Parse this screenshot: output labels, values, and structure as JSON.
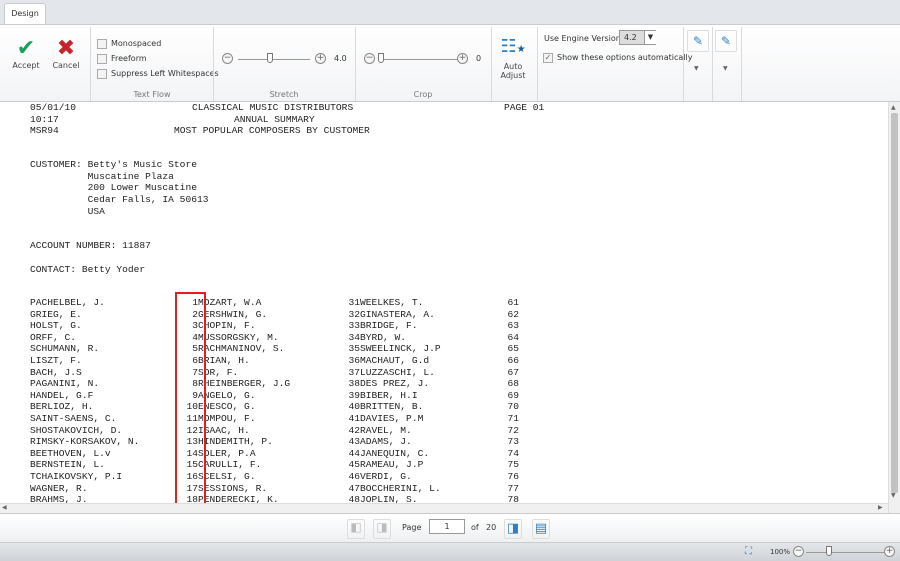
{
  "tabs": [
    {
      "label": "Design"
    }
  ],
  "ribbon": {
    "accept": "Accept",
    "cancel": "Cancel",
    "text_flow": {
      "label": "Text Flow",
      "options": [
        {
          "label": "Monospaced",
          "checked": false
        },
        {
          "label": "Freeform",
          "checked": false
        },
        {
          "label": "Suppress Left Whitespaces",
          "checked": false
        }
      ]
    },
    "stretch": {
      "label": "Stretch",
      "value": "4.0",
      "fraction": 0.45
    },
    "crop": {
      "label": "Crop",
      "value": "0",
      "fraction": 0.0
    },
    "auto_adjust": "Auto Adjust",
    "engine_label": "Use Engine Version",
    "engine_value": "4.2",
    "show_auto": "Show these options automatically",
    "show_auto_checked": true
  },
  "document": {
    "header": [
      {
        "left": "05/01/10",
        "center": "CLASSICAL MUSIC DISTRIBUTORS",
        "right": "PAGE 01"
      },
      {
        "left": "10:17",
        "center": "ANNUAL SUMMARY",
        "right": ""
      },
      {
        "left": "MSR94",
        "center": "MOST POPULAR COMPOSERS BY CUSTOMER",
        "right": ""
      }
    ],
    "customer": [
      "CUSTOMER: Betty's Music Store",
      "          Muscatine Plaza",
      "          200 Lower Muscatine",
      "          Cedar Falls, IA 50613",
      "          USA"
    ],
    "account": "ACCOUNT NUMBER: 11887",
    "contact": "CONTACT: Betty Yoder",
    "rows": [
      [
        "PACHELBEL, J.",
        "1",
        "MOZART, W.A",
        "31",
        "WEELKES, T.",
        "61"
      ],
      [
        "GRIEG, E.",
        "2",
        "GERSHWIN, G.",
        "32",
        "GINASTERA, A.",
        "62"
      ],
      [
        "HOLST, G.",
        "3",
        "CHOPIN, F.",
        "33",
        "BRIDGE, F.",
        "63"
      ],
      [
        "ORFF, C.",
        "4",
        "MUSSORGSKY, M.",
        "34",
        "BYRD, W.",
        "64"
      ],
      [
        "SCHUMANN, R.",
        "5",
        "RACHMANINOV, S.",
        "35",
        "SWEELINCK, J.P",
        "65"
      ],
      [
        "LISZT, F.",
        "6",
        "BRIAN, H.",
        "36",
        "MACHAUT, G.d",
        "66"
      ],
      [
        "BACH, J.S",
        "7",
        "SOR, F.",
        "37",
        "LUZZASCHI, L.",
        "67"
      ],
      [
        "PAGANINI, N.",
        "8",
        "RHEINBERGER, J.G",
        "38",
        "DES PREZ, J.",
        "68"
      ],
      [
        "HANDEL, G.F",
        "9",
        "ANGELO, G.",
        "39",
        "BIBER, H.I",
        "69"
      ],
      [
        "BERLIOZ, H.",
        "10",
        "ENESCO, G.",
        "40",
        "BRITTEN, B.",
        "70"
      ],
      [
        "SAINT-SAENS, C.",
        "11",
        "MOMPOU, F.",
        "41",
        "DAVIES, P.M",
        "71"
      ],
      [
        "SHOSTAKOVICH, D.",
        "12",
        "ISAAC, H.",
        "42",
        "RAVEL, M.",
        "72"
      ],
      [
        "RIMSKY-KORSAKOV, N.",
        "13",
        "HINDEMITH, P.",
        "43",
        "ADAMS, J.",
        "73"
      ],
      [
        "BEETHOVEN, L.v",
        "14",
        "SOLER, P.A",
        "44",
        "JANEQUIN, C.",
        "74"
      ],
      [
        "BERNSTEIN, L.",
        "15",
        "CARULLI, F.",
        "45",
        "RAMEAU, J.P",
        "75"
      ],
      [
        "TCHAIKOVSKY, P.I",
        "16",
        "SCELSI, G.",
        "46",
        "VERDI, G.",
        "76"
      ],
      [
        "WAGNER, R.",
        "17",
        "SESSIONS, R.",
        "47",
        "BOCCHERINI, L.",
        "77"
      ],
      [
        "BRAHMS, J.",
        "18",
        "PENDERECKI, K.",
        "48",
        "JOPLIN, S.",
        "78"
      ]
    ]
  },
  "pager": {
    "page_label": "Page",
    "page_value": "1",
    "of_label": "of",
    "total": "20"
  },
  "status": {
    "zoom": "100%",
    "zoom_fraction": 0.3
  },
  "colors": {
    "accept": "#1a9e5c",
    "cancel": "#c8232c",
    "highlight": "#e02020",
    "accent": "#2f7fc0"
  }
}
